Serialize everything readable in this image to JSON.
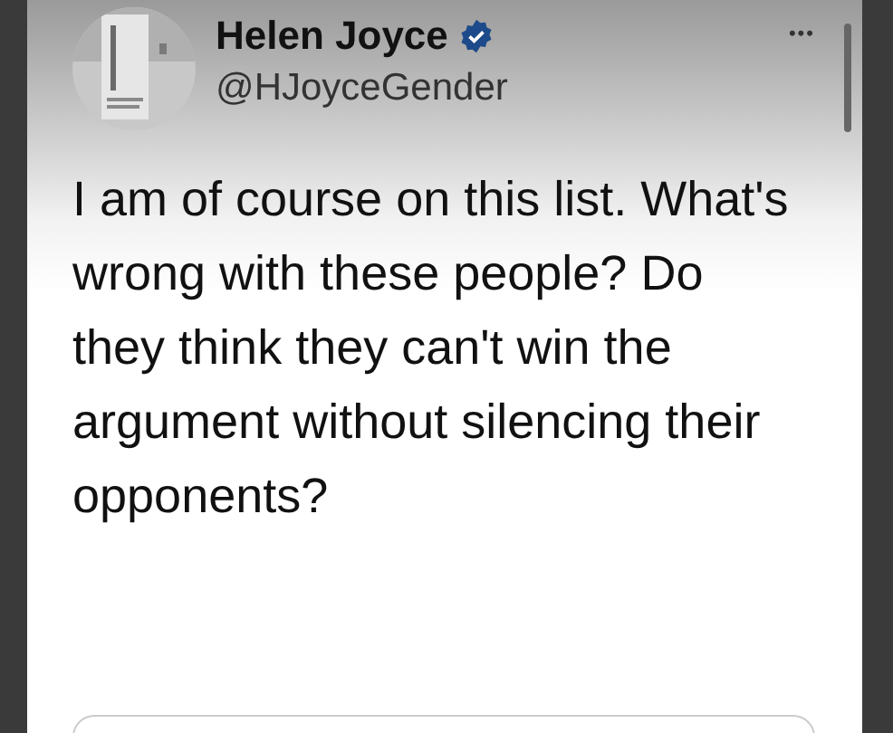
{
  "author": {
    "name": "Helen Joyce",
    "verified": true,
    "handle": "@HJoyceGender"
  },
  "more_button": "•••",
  "tweet": {
    "text": "I am of course on this list. What's wrong with these people? Do they think they can't win the argument without silencing their opponents?"
  }
}
